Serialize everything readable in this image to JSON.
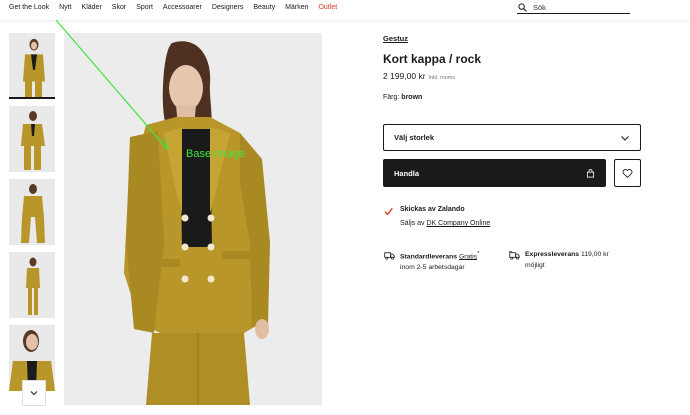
{
  "nav": {
    "items": [
      "Get the Look",
      "Nytt",
      "Kläder",
      "Skor",
      "Sport",
      "Accessoarer",
      "Designers",
      "Beauty",
      "Märken",
      "Outlet"
    ],
    "search_placeholder": "Sök"
  },
  "overlay": {
    "label": "Base Image",
    "color": "#3ee63e"
  },
  "product": {
    "brand": "Gestuz",
    "title": "Kort kappa / rock",
    "price": "2 199,00 kr",
    "vat_note": "Inkl. moms",
    "color_label": "Färg:",
    "color_value": "brown",
    "size_select": "Välj storlek",
    "buy_label": "Handla"
  },
  "shipping": {
    "by": "Skickas av Zalando",
    "sold_prefix": "Säljs av",
    "seller": "DK Company Online"
  },
  "delivery": {
    "standard_label": "Standardleverans",
    "standard_price": "Gratis",
    "standard_mark": "*",
    "standard_time": "inom 2-5 arbetsdagar",
    "express_label": "Expressleverans",
    "express_price": "119,00 kr",
    "express_note": "möjligt"
  },
  "colors": {
    "accent": "#d83a20",
    "mustard": "#b8962a",
    "dark": "#1a1a1a"
  }
}
